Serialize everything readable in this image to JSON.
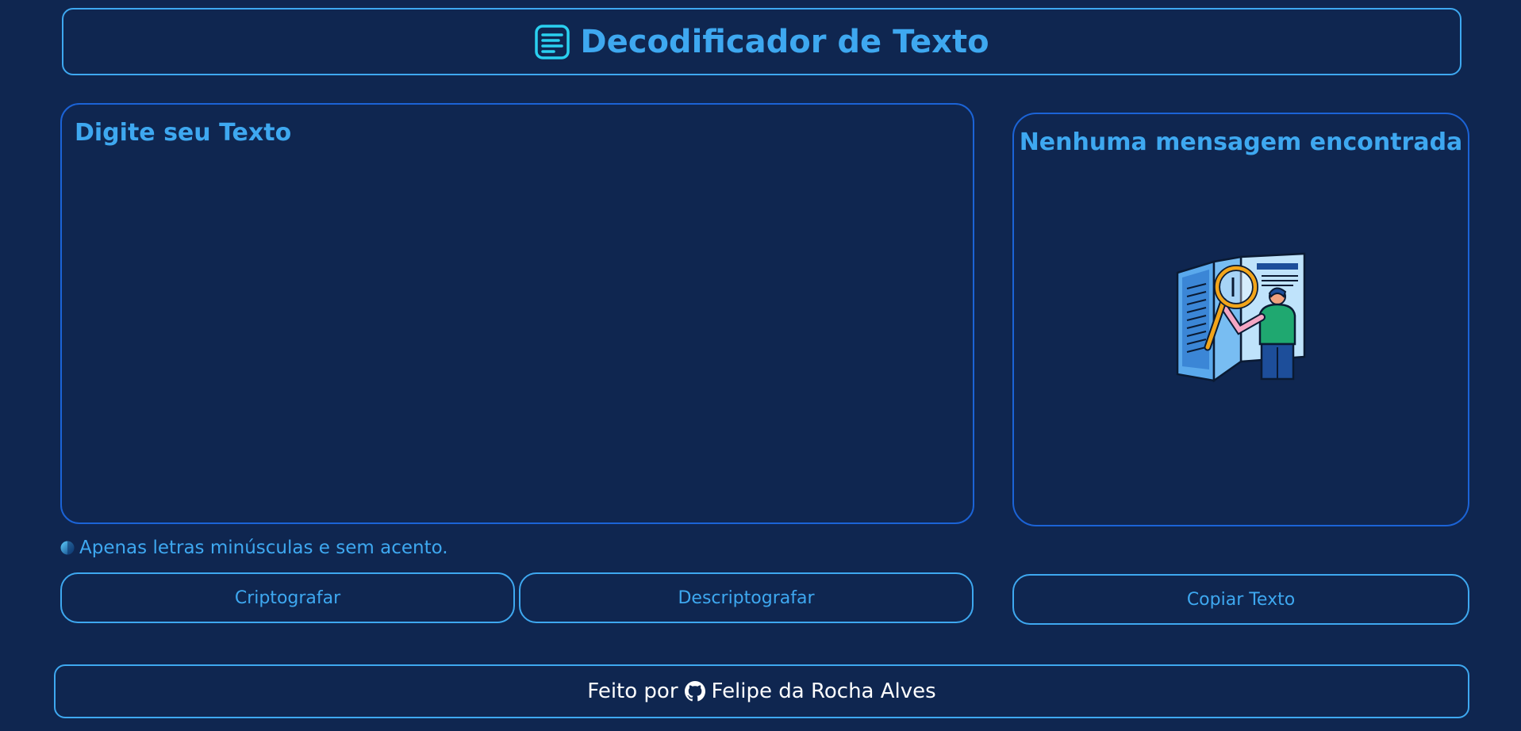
{
  "header": {
    "icon": "document-lines-icon",
    "title": "Decodificador de Texto"
  },
  "input": {
    "placeholder": "Digite seu Texto",
    "value": ""
  },
  "hint": {
    "icon": "info-circle-icon",
    "text": "Apenas letras minúsculas e sem acento."
  },
  "actions": {
    "encrypt_label": "Criptografar",
    "decrypt_label": "Descriptografar",
    "copy_label": "Copiar Texto"
  },
  "output": {
    "title": "Nenhuma mensagem encontrada",
    "illustration": "person-with-magnifier-and-book-illustration"
  },
  "footer": {
    "prefix": "Feito por",
    "icon": "github-icon",
    "author": "Felipe da Rocha Alves"
  },
  "colors": {
    "background": "#0f2650",
    "accent": "#3ea8f0",
    "panel_border": "#1b63d6",
    "footer_text": "#ffffff"
  }
}
